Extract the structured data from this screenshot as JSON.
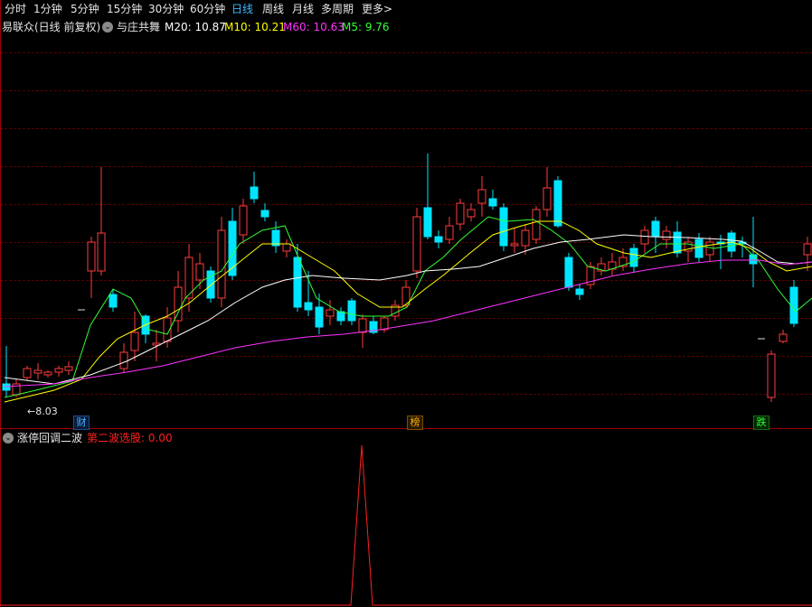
{
  "period_tabs": [
    {
      "label": "分时",
      "active": false
    },
    {
      "label": "1分钟",
      "active": false
    },
    {
      "label": "5分钟",
      "active": false
    },
    {
      "label": "15分钟",
      "active": false
    },
    {
      "label": "30分钟",
      "active": false
    },
    {
      "label": "60分钟",
      "active": false
    },
    {
      "label": "日线",
      "active": true
    },
    {
      "label": "周线",
      "active": false
    },
    {
      "label": "月线",
      "active": false
    },
    {
      "label": "多周期",
      "active": false
    },
    {
      "label": "更多",
      "active": false,
      "suffix": ">"
    }
  ],
  "main_panel": {
    "stock_name": "易联众(日线 前复权)",
    "indicator_name": "与庄共舞",
    "ma20_label": "M20: 10.87",
    "ma10_label": "M10: 10.21",
    "ma60_label": "M60: 10.63",
    "ma5_label": "M5: 9.76",
    "low_price_label": "8.03",
    "event_markers": [
      {
        "label": "财",
        "color": "#3fb8ff"
      },
      {
        "label": "榜",
        "color": "#ffb000"
      },
      {
        "label": "跌",
        "color": "#33ff33"
      }
    ]
  },
  "sub_panel": {
    "indicator_name": "涨停回调二波",
    "signal_label": "第二波选股: 0.00"
  },
  "colors": {
    "up_candle": "#ff3b3b",
    "down_candle": "#00e5ff",
    "ma5": "#ffffff",
    "ma10": "#ffff00",
    "ma20": "#33ff33",
    "ma60": "#ff33ff",
    "signal": "#ff2020"
  },
  "icons": {
    "indicator_dropdown": "chevron-down-circle-icon",
    "more_arrow": "chevron-right-icon",
    "low_price_arrow": "left-arrow-icon"
  }
}
